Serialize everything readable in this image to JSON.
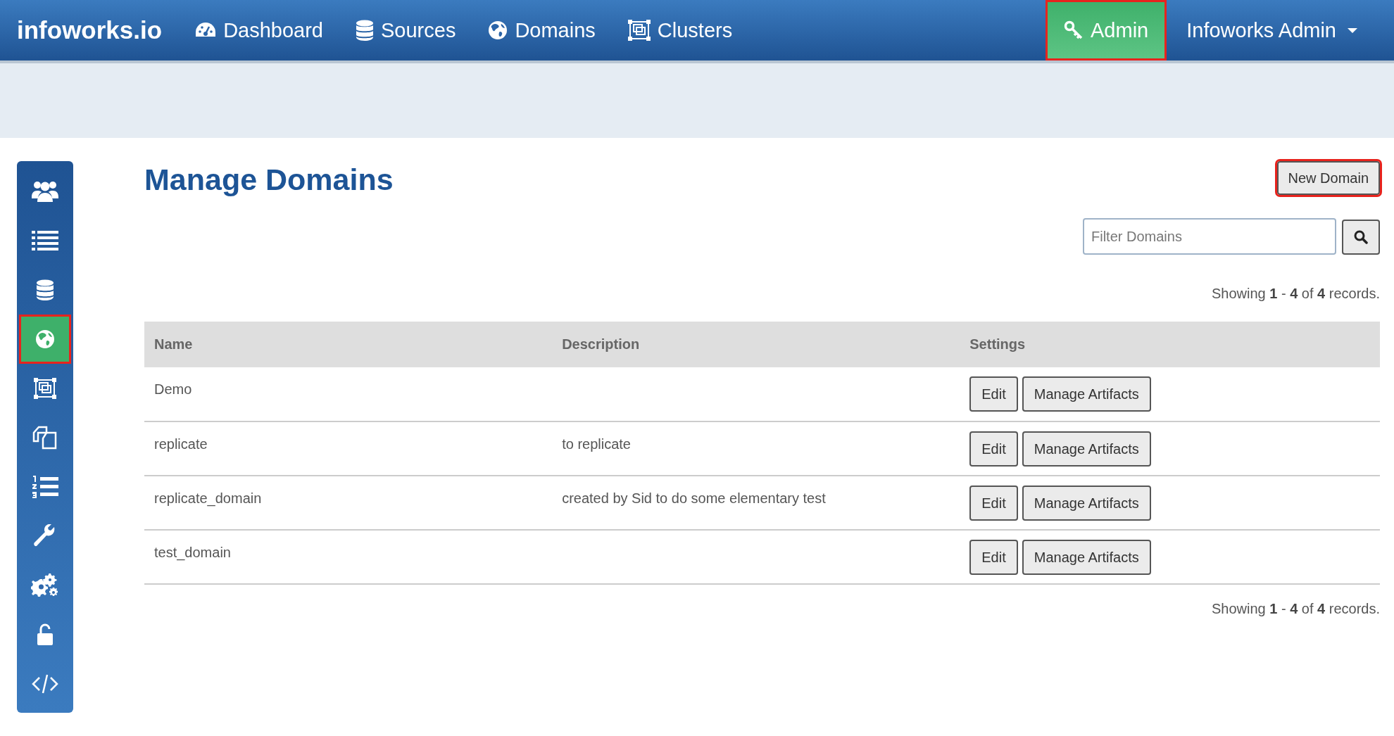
{
  "navbar": {
    "brand": "infoworks.io",
    "items": [
      {
        "label": "Dashboard",
        "selected": false
      },
      {
        "label": "Sources",
        "selected": false
      },
      {
        "label": "Domains",
        "selected": false
      },
      {
        "label": "Clusters",
        "selected": false
      }
    ],
    "admin": {
      "label": "Admin",
      "selected": true,
      "highlighted": true
    },
    "user_menu": {
      "label": "Infoworks Admin"
    }
  },
  "sidebar": {
    "items": [
      {
        "selected": false,
        "highlighted": false
      },
      {
        "selected": false,
        "highlighted": false
      },
      {
        "selected": false,
        "highlighted": false
      },
      {
        "selected": true,
        "highlighted": true
      },
      {
        "selected": false,
        "highlighted": false
      },
      {
        "selected": false,
        "highlighted": false
      },
      {
        "selected": false,
        "highlighted": false
      },
      {
        "selected": false,
        "highlighted": false
      },
      {
        "selected": false,
        "highlighted": false
      },
      {
        "selected": false,
        "highlighted": false
      },
      {
        "selected": false,
        "highlighted": false
      }
    ]
  },
  "page": {
    "title": "Manage Domains",
    "new_button": {
      "label": "New Domain",
      "highlighted": true
    },
    "filter": {
      "placeholder": "Filter Domains"
    },
    "records_top": "Showing **1** - **4** of **4** records.",
    "table": {
      "columns": [
        "Name",
        "Description",
        "Settings"
      ],
      "rows": [
        {
          "name": "Demo",
          "description": "",
          "actions": [
            "Edit",
            "Manage Artifacts"
          ]
        },
        {
          "name": "replicate",
          "description": "to replicate",
          "actions": [
            "Edit",
            "Manage Artifacts"
          ]
        },
        {
          "name": "replicate_domain",
          "description": "created by Sid to do some elementary test",
          "actions": [
            "Edit",
            "Manage Artifacts"
          ]
        },
        {
          "name": "test_domain",
          "description": "",
          "actions": [
            "Edit",
            "Manage Artifacts"
          ]
        }
      ]
    },
    "records_bottom": "Showing **1** - **4** of **4** records."
  }
}
